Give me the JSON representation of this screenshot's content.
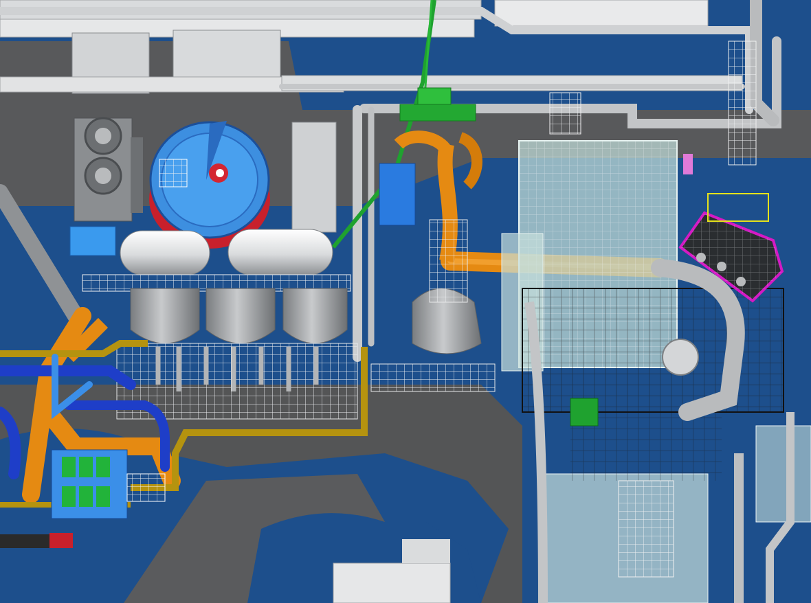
{
  "view": {
    "type": "3d-plant-model",
    "background_color": "#1d4f8c"
  },
  "colors": {
    "water": "#1d4f8c",
    "ground": "#555759",
    "concrete": "#d6d8da",
    "steel": "#c9cbcd",
    "orange_pipe": "#e58a12",
    "blue_pipe": "#1e3ec8",
    "light_blue_pipe": "#3b8fe8",
    "olive_pipe": "#b5930f",
    "green_pipe": "#1fa22f",
    "magenta_outline": "#d41ac4",
    "red_accent": "#c8202c",
    "yellow_accent": "#e6e21a",
    "glass_building": "#bcd8d4"
  },
  "components": [
    "storage-tanks",
    "cylindrical-vessels",
    "round-clarifier-tank",
    "cooling-fan-unit",
    "orange-main-duct",
    "transformer-skid",
    "green-crane",
    "steel-frame-structure",
    "glass-enclosure"
  ]
}
